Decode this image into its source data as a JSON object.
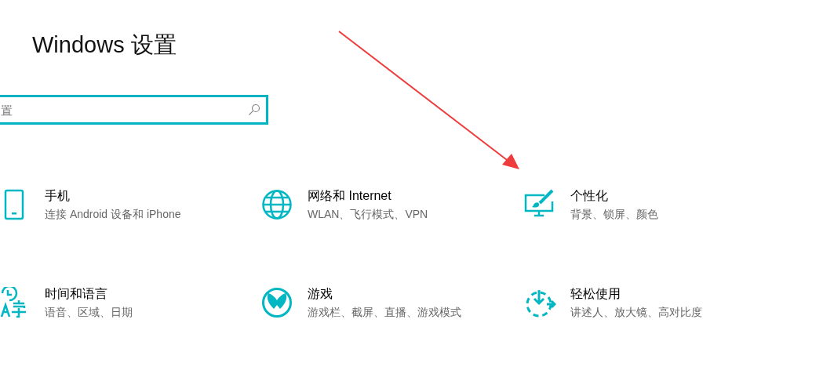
{
  "window": {
    "title": "Windows 设置"
  },
  "search": {
    "placeholder": "置"
  },
  "categories": [
    {
      "kind": "phone",
      "title": "手机",
      "subtitle": "连接 Android 设备和 iPhone"
    },
    {
      "kind": "network",
      "title": "网络和 Internet",
      "subtitle": "WLAN、飞行模式、VPN"
    },
    {
      "kind": "personalization",
      "title": "个性化",
      "subtitle": "背景、锁屏、颜色"
    },
    {
      "kind": "time",
      "title": "时间和语言",
      "subtitle": "语音、区域、日期"
    },
    {
      "kind": "gaming",
      "title": "游戏",
      "subtitle": "游戏栏、截屏、直播、游戏模式"
    },
    {
      "kind": "ease",
      "title": "轻松使用",
      "subtitle": "讲述人、放大镜、高对比度"
    }
  ]
}
